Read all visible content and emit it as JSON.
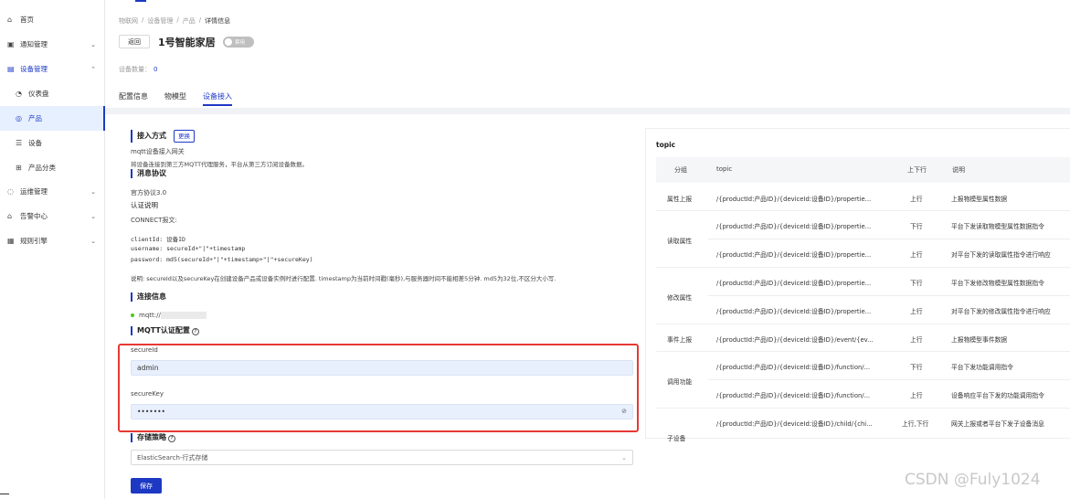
{
  "sidebar": {
    "items": [
      {
        "icon": "home-icon",
        "glyph": "⌂",
        "label": "首页",
        "chev": ""
      },
      {
        "icon": "notice-icon",
        "glyph": "▣",
        "label": "通知管理",
        "chev": "⌄"
      },
      {
        "icon": "device-mgmt-icon",
        "glyph": "▤",
        "label": "设备管理",
        "chev": "⌃"
      },
      {
        "icon": "dashboard-icon",
        "glyph": "◔",
        "label": "仪表盘",
        "chev": ""
      },
      {
        "icon": "product-icon",
        "glyph": "◎",
        "label": "产品",
        "chev": ""
      },
      {
        "icon": "device-icon",
        "glyph": "☰",
        "label": "设备",
        "chev": ""
      },
      {
        "icon": "category-icon",
        "glyph": "⊞",
        "label": "产品分类",
        "chev": ""
      },
      {
        "icon": "ops-icon",
        "glyph": "◌",
        "label": "运维管理",
        "chev": "⌄"
      },
      {
        "icon": "alarm-icon",
        "glyph": "⌂",
        "label": "告警中心",
        "chev": "⌄"
      },
      {
        "icon": "rule-engine-icon",
        "glyph": "▦",
        "label": "规则引擎",
        "chev": "⌄"
      }
    ]
  },
  "breadcrumb": {
    "items": [
      "物联网",
      "/",
      "设备管理",
      "/",
      "产品",
      "/"
    ],
    "current": "详情信息"
  },
  "header": {
    "back_label": "返回",
    "title": "1号智能家居",
    "toggle_label": "禁用",
    "device_count_label": "设备数量：",
    "device_count": "0"
  },
  "tabs": [
    "配置信息",
    "物模型",
    "设备接入"
  ],
  "access": {
    "section_access": "接入方式",
    "change_label": "更换",
    "access_name": "mqtt设备接入网关",
    "access_desc": "将设备连接到第三方MQTT代理服务，平台从第三方订阅设备数据。",
    "section_protocol": "消息协议",
    "protocol_name": "官方协议3.0",
    "auth_title": "认证说明",
    "connect_title": "CONNECT报文:",
    "code_line1": "clientId: 设备ID",
    "code_line2": "username: secureId+\"|\"+timestamp",
    "code_line3": "password: md5(secureId+\"|\"+timestamp+\"|\"+secureKey)",
    "note": "说明: secureId以及secureKey在创建设备产品或设备实例时进行配置. timestamp为当前时间戳(毫秒),与服务器时间不能相差5分钟. md5为32位,不区分大小写.",
    "section_connect": "连接信息",
    "connect_url": "mqtt://",
    "section_mqtt": "MQTT认证配置",
    "secureid_label": "secureId",
    "secureid_value": "admin",
    "securekey_label": "secureKey",
    "securekey_value": "•••••••",
    "section_storage": "存储策略",
    "storage_value": "ElasticSearch-行式存储",
    "save_label": "保存"
  },
  "topic_table": {
    "title": "topic",
    "headers": [
      "分组",
      "topic",
      "上下行",
      "说明"
    ],
    "groups": [
      "属性上报",
      "读取属性",
      "修改属性",
      "事件上报",
      "调用功能",
      "子设备"
    ],
    "rows": [
      {
        "topic": "/{productId:产品ID}/{deviceId:设备ID}/propertie...",
        "dir": "上行",
        "desc": "上报物模型属性数据"
      },
      {
        "topic": "/{productId:产品ID}/{deviceId:设备ID}/propertie...",
        "dir": "下行",
        "desc": "平台下发读取物模型属性数据指令"
      },
      {
        "topic": "/{productId:产品ID}/{deviceId:设备ID}/propertie...",
        "dir": "上行",
        "desc": "对平台下发的读取属性指令进行响应"
      },
      {
        "topic": "/{productId:产品ID}/{deviceId:设备ID}/propertie...",
        "dir": "下行",
        "desc": "平台下发修改物模型属性数据指令"
      },
      {
        "topic": "/{productId:产品ID}/{deviceId:设备ID}/propertie...",
        "dir": "上行",
        "desc": "对平台下发的修改属性指令进行响应"
      },
      {
        "topic": "/{productId:产品ID}/{deviceId:设备ID}/event/{ev...",
        "dir": "上行",
        "desc": "上报物模型事件数据"
      },
      {
        "topic": "/{productId:产品ID}/{deviceId:设备ID}/function/...",
        "dir": "下行",
        "desc": "平台下发功能调用指令"
      },
      {
        "topic": "/{productId:产品ID}/{deviceId:设备ID}/function/...",
        "dir": "上行",
        "desc": "设备响应平台下发的功能调用指令"
      },
      {
        "topic": "/{productId:产品ID}/{deviceId:设备ID}/child/{chi...",
        "dir": "上行,下行",
        "desc": "网关上报或者平台下发子设备消息"
      }
    ]
  },
  "watermark": "CSDN @Fuly1024",
  "colors": {
    "accent": "#1d39c4",
    "highlight_box": "#e53935",
    "input_bg": "#e8f0fe"
  }
}
